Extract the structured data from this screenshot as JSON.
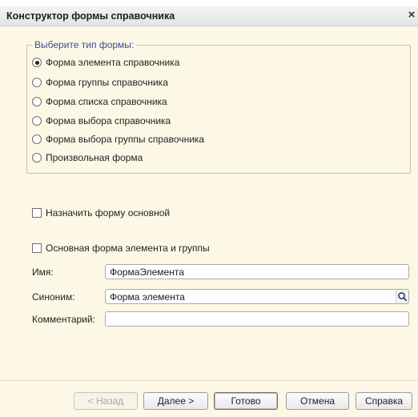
{
  "window": {
    "title": "Конструктор формы справочника",
    "close_glyph": "×"
  },
  "form_type": {
    "legend": "Выберите тип формы:",
    "options": [
      {
        "label": "Форма элемента справочника",
        "checked": true
      },
      {
        "label": "Форма группы справочника",
        "checked": false
      },
      {
        "label": "Форма списка справочника",
        "checked": false
      },
      {
        "label": "Форма выбора справочника",
        "checked": false
      },
      {
        "label": "Форма выбора группы справочника",
        "checked": false
      },
      {
        "label": "Произвольная форма",
        "checked": false
      }
    ]
  },
  "options": {
    "set_main": {
      "label": "Назначить форму основной",
      "checked": false
    },
    "main_element_group": {
      "label": "Основная форма элемента и группы",
      "checked": false
    }
  },
  "fields": {
    "name": {
      "label": "Имя:",
      "value": "ФормаЭлемента"
    },
    "synonym": {
      "label": "Синоним:",
      "value": "Форма элемента"
    },
    "comment": {
      "label": "Комментарий:",
      "value": ""
    }
  },
  "buttons": {
    "back": "< Назад",
    "next": "Далее >",
    "done": "Готово",
    "cancel": "Отмена",
    "help": "Справка"
  }
}
